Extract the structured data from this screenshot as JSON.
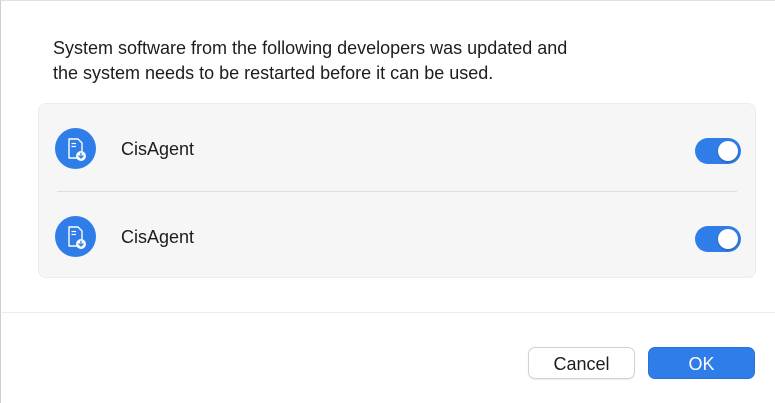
{
  "dialog": {
    "message_line1": "System software from the following developers was updated and",
    "message_line2": "the system needs to be restarted before it can be used."
  },
  "developers": [
    {
      "name": "CisAgent",
      "icon": "document-download-icon",
      "enabled": true
    },
    {
      "name": "CisAgent",
      "icon": "document-download-icon",
      "enabled": true
    }
  ],
  "buttons": {
    "cancel_label": "Cancel",
    "ok_label": "OK"
  },
  "colors": {
    "accent": "#2f7de8",
    "list_background": "#f6f6f6"
  }
}
